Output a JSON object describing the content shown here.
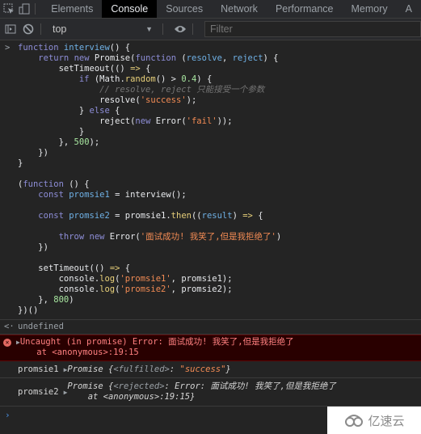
{
  "tabbar": {
    "tabs": [
      {
        "label": "Elements",
        "active": false
      },
      {
        "label": "Console",
        "active": true
      },
      {
        "label": "Sources",
        "active": false
      },
      {
        "label": "Network",
        "active": false
      },
      {
        "label": "Performance",
        "active": false
      },
      {
        "label": "Memory",
        "active": false
      },
      {
        "label": "A",
        "active": false
      }
    ]
  },
  "toolbar": {
    "context": "top",
    "filter_placeholder": "Filter"
  },
  "console": {
    "prompt": ">",
    "code": {
      "l1": [
        "function",
        " interview",
        "() {"
      ],
      "l2": [
        "return",
        "new",
        "Promise(",
        "function",
        "resolve",
        "reject",
        ") {"
      ],
      "l3": [
        "setTimeout(() ",
        "=>",
        " {"
      ],
      "l4": [
        "if",
        " (Math.",
        "random",
        "() > ",
        "0.4",
        ") {"
      ],
      "l5": "// resolve, reject 只能接受一个参数",
      "l6": [
        "resolve(",
        "'success'",
        ");"
      ],
      "l7": [
        "} ",
        "else",
        " {"
      ],
      "l8": [
        "reject(",
        "new",
        " Error(",
        "'fail'",
        "));"
      ],
      "l9": "}",
      "l10": [
        "}, ",
        "500",
        ");"
      ],
      "l11": "})",
      "l12": "}",
      "l13": [
        "(",
        "function",
        " () {"
      ],
      "l14": [
        "const",
        " promsie1",
        " = interview();"
      ],
      "l15": [
        "const",
        " promsie2",
        " = promsie1.",
        "then",
        "((",
        "result",
        ") ",
        "=>",
        " {"
      ],
      "l16": [
        "throw",
        "new",
        " Error(",
        "'面试成功! 我笑了,但是我拒绝了'",
        ")"
      ],
      "l17": "})",
      "l18": [
        "setTimeout(() ",
        "=>",
        " {"
      ],
      "l19": [
        "console.",
        "log",
        "(",
        "'promsie1'",
        ", promsie1);"
      ],
      "l20": [
        "console.",
        "log",
        "(",
        "'promsie2'",
        ", promsie2);"
      ],
      "l21": [
        "}, ",
        "800",
        ")"
      ],
      "l22": "})()"
    },
    "return_prompt": "<·",
    "return_value": "undefined",
    "error": {
      "line1": "Uncaught (in promise) Error: 面试成功! 我笑了,但是我拒绝了",
      "line2": "at <anonymous>:19:15"
    },
    "logs": [
      {
        "label": "promsie1",
        "obj_prefix": "Promise {",
        "key": "<fulfilled>",
        "sep": ": ",
        "value": "\"success\"",
        "suffix": "}"
      },
      {
        "label": "promsie2",
        "obj_prefix": "Promise {",
        "key": "<rejected>",
        "sep": ": Error: 面试成功! 我笑了,但是我拒绝了",
        "line2": "at <anonymous>:19:15}"
      }
    ]
  },
  "watermark": {
    "text": "亿速云"
  }
}
